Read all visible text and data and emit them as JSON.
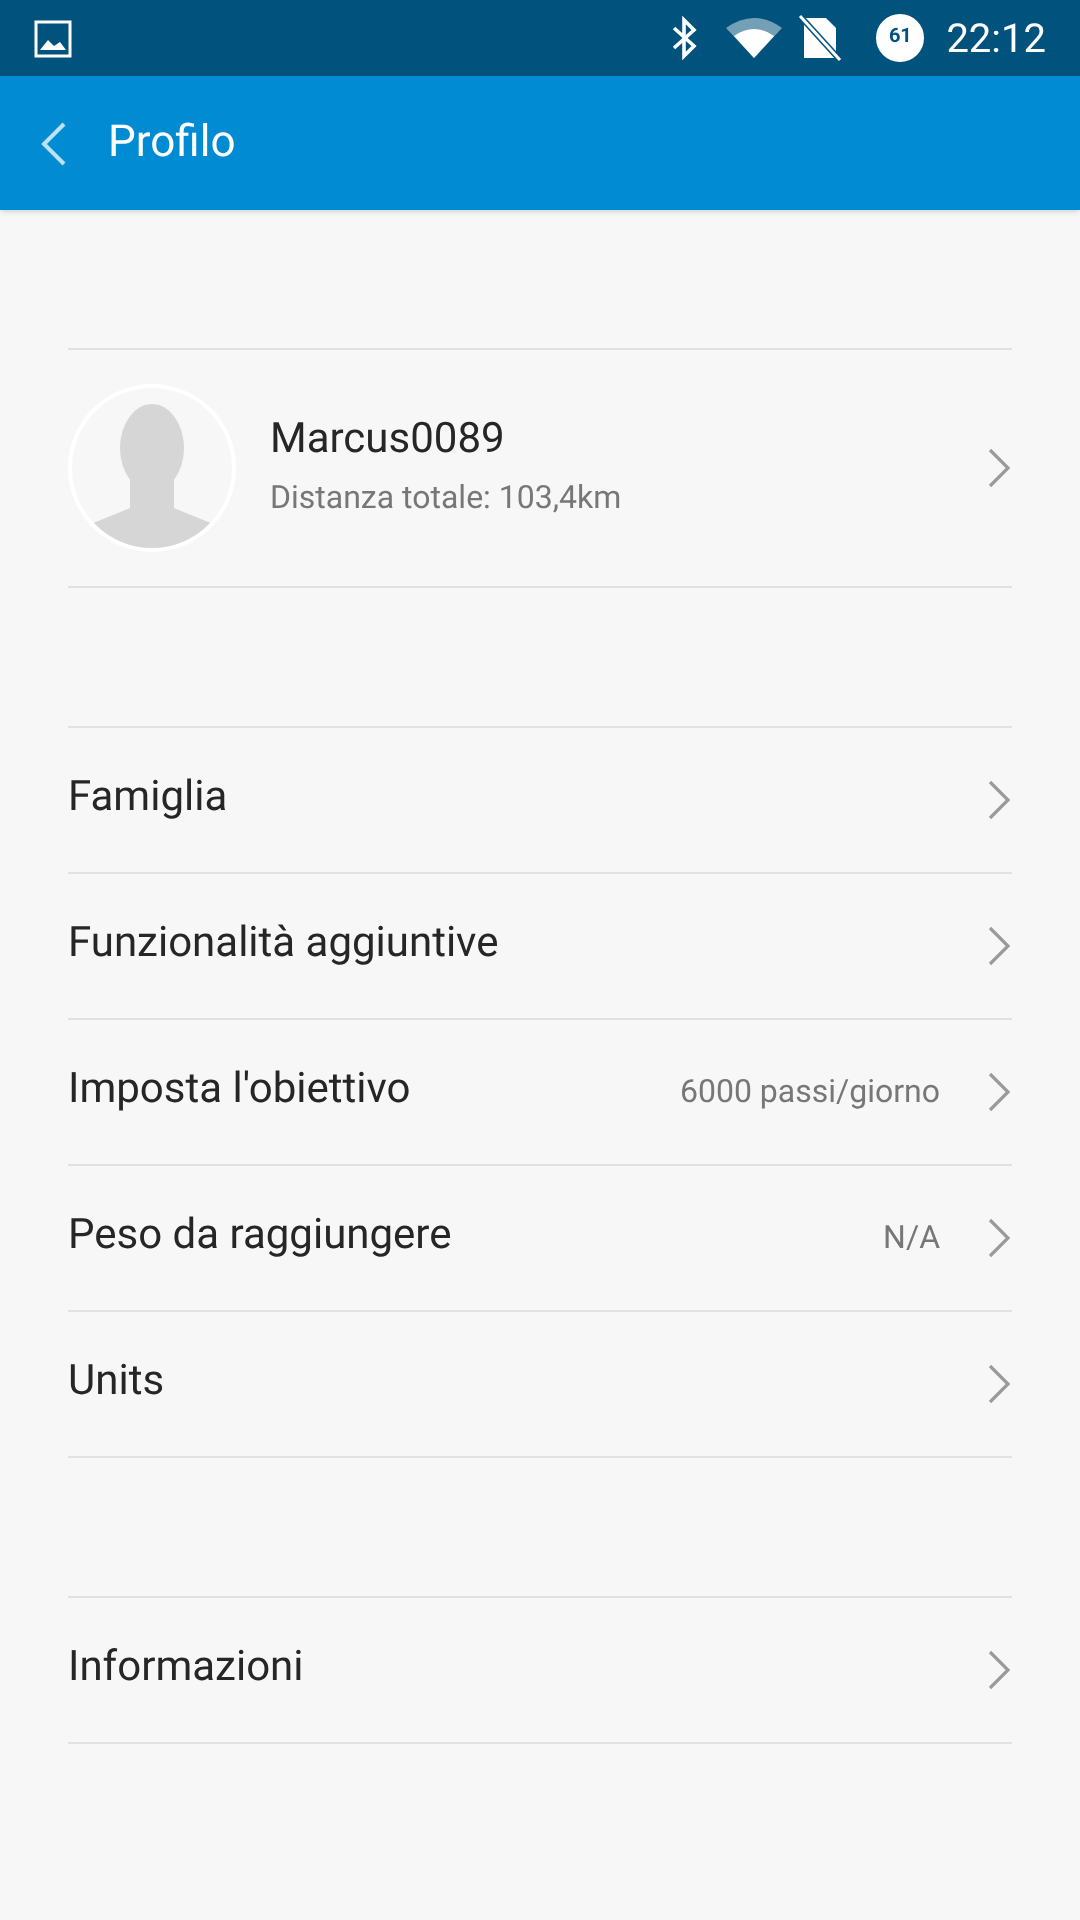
{
  "status_bar": {
    "battery": "61",
    "time": "22:12"
  },
  "app_bar": {
    "title": "Profilo"
  },
  "profile": {
    "username": "Marcus0089",
    "subtitle": "Distanza totale: 103,4km"
  },
  "groups": [
    {
      "items": [
        {
          "label": "Famiglia"
        },
        {
          "label": "Funzionalità aggiuntive"
        },
        {
          "label": "Imposta l'obiettivo",
          "value": "6000 passi/giorno"
        },
        {
          "label": "Peso da raggiungere",
          "value": "N/A"
        },
        {
          "label": "Units"
        }
      ]
    },
    {
      "items": [
        {
          "label": "Informazioni"
        }
      ]
    }
  ]
}
